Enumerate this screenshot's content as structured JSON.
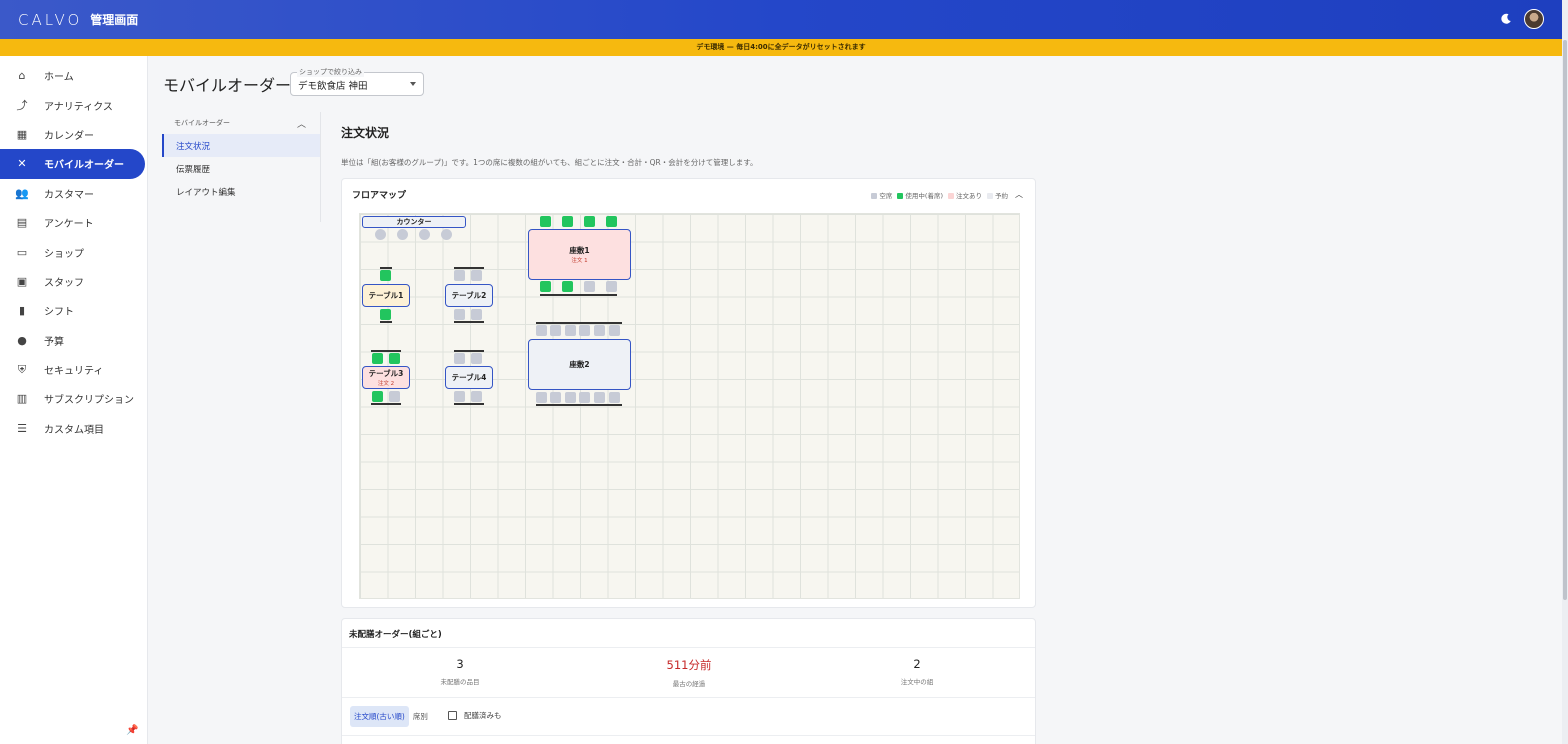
{
  "header": {
    "brand": "CALVO",
    "subtitle": "管理画面",
    "theme_icon": "moon-icon",
    "avatar": "user-avatar"
  },
  "banner": {
    "text": "デモ環境 — 毎日4:00に全データがリセットされます"
  },
  "sidebar": {
    "items": [
      {
        "label": "ホーム",
        "icon": "home-icon",
        "glyph": "⌂",
        "active": false
      },
      {
        "label": "アナリティクス",
        "icon": "analytics-icon",
        "glyph": "⤴",
        "active": false
      },
      {
        "label": "カレンダー",
        "icon": "calendar-icon",
        "glyph": "▦",
        "active": false
      },
      {
        "label": "モバイルオーダー",
        "icon": "utensils-icon",
        "glyph": "✕",
        "active": true
      },
      {
        "label": "カスタマー",
        "icon": "people-icon",
        "glyph": "👥",
        "active": false
      },
      {
        "label": "アンケート",
        "icon": "clipboard-icon",
        "glyph": "▤",
        "active": false
      },
      {
        "label": "ショップ",
        "icon": "store-icon",
        "glyph": "▭",
        "active": false
      },
      {
        "label": "スタッフ",
        "icon": "badge-icon",
        "glyph": "▣",
        "active": false
      },
      {
        "label": "シフト",
        "icon": "columns-icon",
        "glyph": "▮",
        "active": false
      },
      {
        "label": "予算",
        "icon": "piggy-bank-icon",
        "glyph": "●",
        "active": false
      },
      {
        "label": "セキュリティ",
        "icon": "shield-icon",
        "glyph": "⛨",
        "active": false
      },
      {
        "label": "サブスクリプション",
        "icon": "subscription-icon",
        "glyph": "▥",
        "active": false
      },
      {
        "label": "カスタム項目",
        "icon": "sliders-icon",
        "glyph": "☰",
        "active": false
      }
    ],
    "pin_icon": "pin-icon"
  },
  "page": {
    "title": "モバイルオーダー",
    "shop_filter_label": "ショップで絞り込み",
    "shop_filter_value": "デモ飲食店 神田"
  },
  "subnav": {
    "section": "モバイルオーダー",
    "items": [
      {
        "label": "注文状況",
        "active": true
      },
      {
        "label": "伝票履歴",
        "active": false
      },
      {
        "label": "レイアウト編集",
        "active": false
      }
    ]
  },
  "content": {
    "title": "注文状況",
    "description": "単位は「組(お客様のグループ)」です。1つの席に複数の組がいても、組ごとに注文・合計・QR・会計を分けて管理します。"
  },
  "floor": {
    "title": "フロアマップ",
    "legend": [
      {
        "label": "空席",
        "color": "#c7cbd6"
      },
      {
        "label": "使用中(着席)",
        "color": "#22c55e"
      },
      {
        "label": "注文あり",
        "color": "#fbd5d5"
      },
      {
        "label": "予約",
        "color": "#e9ebf0"
      }
    ],
    "tables": [
      {
        "name": "カウンター",
        "order": ""
      },
      {
        "name": "座敷1",
        "order": "注文 1"
      },
      {
        "name": "テーブル1",
        "order": ""
      },
      {
        "name": "テーブル2",
        "order": ""
      },
      {
        "name": "座敷2",
        "order": ""
      },
      {
        "name": "テーブル3",
        "order": "注文 2"
      },
      {
        "name": "テーブル4",
        "order": ""
      }
    ],
    "colors": {
      "order": "#fde0e0",
      "seated": "#fdf1d6",
      "empty": "#eef1f6"
    }
  },
  "orders": {
    "title": "未配膳オーダー(組ごと)",
    "stats": [
      {
        "value": "3",
        "label": "未配膳の品目",
        "red": false
      },
      {
        "value": "511分前",
        "label": "最古の経過",
        "red": true
      },
      {
        "value": "2",
        "label": "注文中の組",
        "red": false
      }
    ],
    "tabs": [
      "注文順(古い順)",
      "席別"
    ],
    "checkbox_label": "配膳済みも"
  }
}
